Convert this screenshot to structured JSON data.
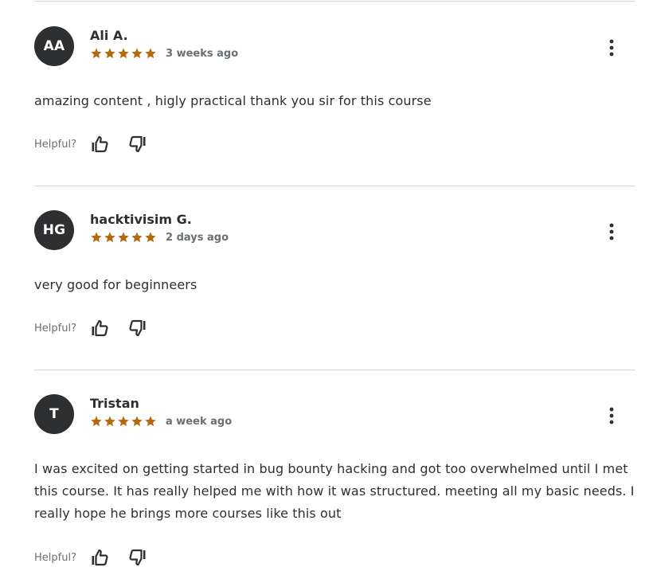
{
  "colors": {
    "star": "#b4690e",
    "text": "#2d2f31",
    "muted": "#6a6f73",
    "avatar_bg": "#2d2f31",
    "divider": "#d1d7dc"
  },
  "helpful_label": "Helpful?",
  "reviews": [
    {
      "initials": "AA",
      "name": "Ali A.",
      "rating": 5,
      "time": "3 weeks ago",
      "content": "amazing content , higly practical thank you sir for this course"
    },
    {
      "initials": "HG",
      "name": "hacktivisim G.",
      "rating": 5,
      "time": "2 days ago",
      "content": "very good for beginneers"
    },
    {
      "initials": "T",
      "name": "Tristan",
      "rating": 5,
      "time": "a week ago",
      "content": "I was excited on getting started in bug bounty hacking and got too overwhelmed until I met this course. It has really helped me with how it was structured. meeting all my basic needs. I really hope he brings more courses like this out"
    }
  ],
  "icons": {
    "more": "more-vertical-icon",
    "thumb_up": "thumbs-up-icon",
    "thumb_down": "thumbs-down-icon",
    "star": "star-icon"
  }
}
